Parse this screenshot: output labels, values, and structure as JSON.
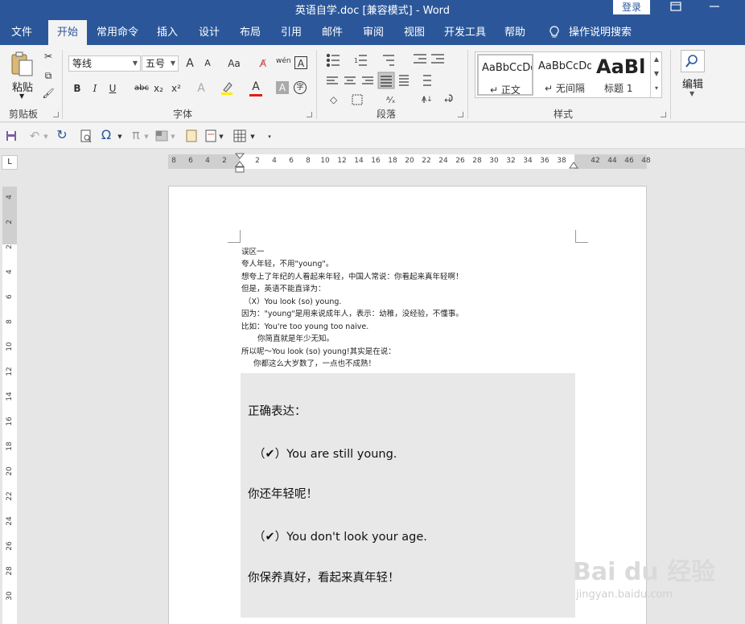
{
  "titlebar": {
    "title": "英语自学.doc [兼容模式]  -  Word",
    "login": "登录",
    "restore_icon": "restore-icon",
    "minimize_icon": "minimize-icon"
  },
  "tabs": [
    "文件",
    "开始",
    "常用命令",
    "插入",
    "设计",
    "布局",
    "引用",
    "邮件",
    "审阅",
    "视图",
    "开发工具",
    "帮助",
    "操作说明搜索"
  ],
  "ribbon": {
    "clipboard": {
      "label": "剪贴板",
      "paste": "粘贴"
    },
    "font": {
      "label": "字体",
      "font_name": "等线",
      "font_size": "五号",
      "grow": "A",
      "shrink": "A",
      "case": "Aa",
      "phonetic": "wén",
      "border_char": "A",
      "bold": "B",
      "italic": "I",
      "underline": "U",
      "strike": "abc",
      "subscript": "x₂",
      "superscript": "x²",
      "text_effect": "A",
      "font_color": "A",
      "shading_char": "A",
      "enclose": "字"
    },
    "paragraph": {
      "label": "段落"
    },
    "styles": {
      "label": "样式",
      "items": [
        {
          "preview": "AaBbCcDd",
          "name": "正文"
        },
        {
          "preview": "AaBbCcDd",
          "name": "无间隔"
        },
        {
          "preview": "AaBl",
          "name": "标题 1"
        }
      ]
    },
    "editing": {
      "label": "编辑"
    }
  },
  "ruler": {
    "corner": "L",
    "h_ticks": [
      "8",
      "6",
      "4",
      "2",
      "2",
      "4",
      "6",
      "8",
      "10",
      "12",
      "14",
      "16",
      "18",
      "20",
      "22",
      "24",
      "26",
      "28",
      "30",
      "32",
      "34",
      "36",
      "38",
      "42",
      "44",
      "46",
      "48"
    ],
    "v_ticks": [
      "4",
      "2",
      "2",
      "4",
      "6",
      "8",
      "10",
      "12",
      "14",
      "16",
      "18",
      "20",
      "22",
      "24",
      "26",
      "28",
      "30"
    ]
  },
  "document": {
    "lines": [
      "误区一",
      "夸人年轻，不用\"young\"。",
      "想夸上了年纪的人看起来年轻，中国人常说：你看起来真年轻啊！",
      "但是，英语不能直译为：",
      "（X）You look (so) young.",
      "因为：\"young\"是用来说成年人，表示：幼稚，没经验，不懂事。",
      "比如：You're too young too naive.",
      "      你简直就是年少无知。",
      "所以呢～You look (so) young!其实是在说：",
      "    你都这么大岁数了，一点也不成熟！"
    ],
    "callout": [
      "正确表达：",
      "（✔）You are still young.",
      "你还年轻呢！",
      "（✔）You don't look your age.",
      "你保养真好，看起来真年轻！"
    ]
  },
  "watermark": {
    "brand": "Bai du 经验",
    "url": "jingyan.baidu.com"
  }
}
